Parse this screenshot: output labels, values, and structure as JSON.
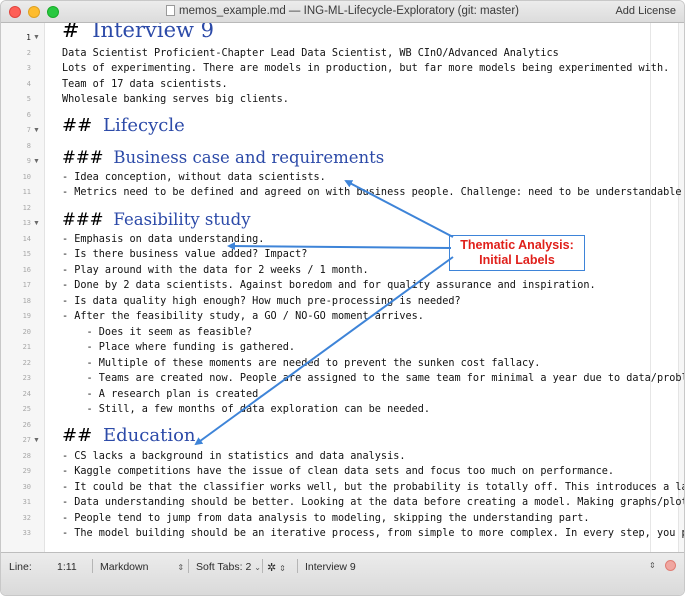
{
  "window": {
    "title": "memos_example.md — ING-ML-Lifecycle-Exploratory (git: master)",
    "add_license": "Add License"
  },
  "lines": [
    {
      "num": "1",
      "fold": "▼",
      "active": true,
      "kind": "h1",
      "hash": "#",
      "text": "Interview 9"
    },
    {
      "num": "2",
      "text": "Data Scientist Proficient-Chapter Lead Data Scientist, WB CInO/Advanced Analytics"
    },
    {
      "num": "3",
      "text": "Lots of experimenting. There are models in production, but far more models being experimented with."
    },
    {
      "num": "4",
      "text": "Team of 17 data scientists."
    },
    {
      "num": "5",
      "text": "Wholesale banking serves big clients."
    },
    {
      "num": "6",
      "text": ""
    },
    {
      "num": "7",
      "fold": "▼",
      "kind": "h2",
      "hash": "##",
      "text": "Lifecycle"
    },
    {
      "num": "8",
      "text": ""
    },
    {
      "num": "9",
      "fold": "▼",
      "kind": "h3",
      "hash": "###",
      "text": "Business case and requirements"
    },
    {
      "num": "10",
      "text": "- Idea conception, without data scientists."
    },
    {
      "num": "11",
      "text": "- Metrics need to be defined and agreed on with business people. Challenge: need to be understandable t"
    },
    {
      "num": "12",
      "text": ""
    },
    {
      "num": "13",
      "fold": "▼",
      "kind": "h3",
      "hash": "###",
      "text": "Feasibility study"
    },
    {
      "num": "14",
      "text": "- Emphasis on data understanding."
    },
    {
      "num": "15",
      "text": "- Is there business value added? Impact?"
    },
    {
      "num": "16",
      "text": "- Play around with the data for 2 weeks / 1 month."
    },
    {
      "num": "17",
      "text": "- Done by 2 data scientists. Against boredom and for quality assurance and inspiration."
    },
    {
      "num": "18",
      "text": "- Is data quality high enough? How much pre-processing is needed?"
    },
    {
      "num": "19",
      "text": "- After the feasibility study, a GO / NO-GO moment arrives."
    },
    {
      "num": "20",
      "text": "    - Does it seem as feasible?"
    },
    {
      "num": "21",
      "text": "    - Place where funding is gathered."
    },
    {
      "num": "22",
      "text": "    - Multiple of these moments are needed to prevent the sunken cost fallacy."
    },
    {
      "num": "23",
      "text": "    - Teams are created now. People are assigned to the same team for minimal a year due to data/proble"
    },
    {
      "num": "24",
      "text": "    - A research plan is created."
    },
    {
      "num": "25",
      "text": "    - Still, a few months of data exploration can be needed."
    },
    {
      "num": "26",
      "text": ""
    },
    {
      "num": "27",
      "fold": "▼",
      "kind": "h2",
      "hash": "##",
      "text": "Education"
    },
    {
      "num": "28",
      "text": "- CS lacks a background in statistics and data analysis."
    },
    {
      "num": "29",
      "text": "- Kaggle competitions have the issue of clean data sets and focus too much on performance."
    },
    {
      "num": "30",
      "text": "- It could be that the classifier works well, but the probability is totally off. This introduces a lar"
    },
    {
      "num": "31",
      "text": "- Data understanding should be better. Looking at the data before creating a model. Making graphs/plots"
    },
    {
      "num": "32",
      "text": "- People tend to jump from data analysis to modeling, skipping the understanding part."
    },
    {
      "num": "33",
      "text": "- The model building should be an iterative process, from simple to more complex. In every step, you pr"
    }
  ],
  "annotation": {
    "line1": "Thematic Analysis:",
    "line2": "Initial Labels",
    "color": "#e0201b",
    "arrow_color": "#3e84d8"
  },
  "statusbar": {
    "line_label": "Line:",
    "position": "1:11",
    "language": "Markdown",
    "tabs_label": "Soft Tabs:",
    "tabs_value": "2",
    "symbol": "Interview 9"
  }
}
